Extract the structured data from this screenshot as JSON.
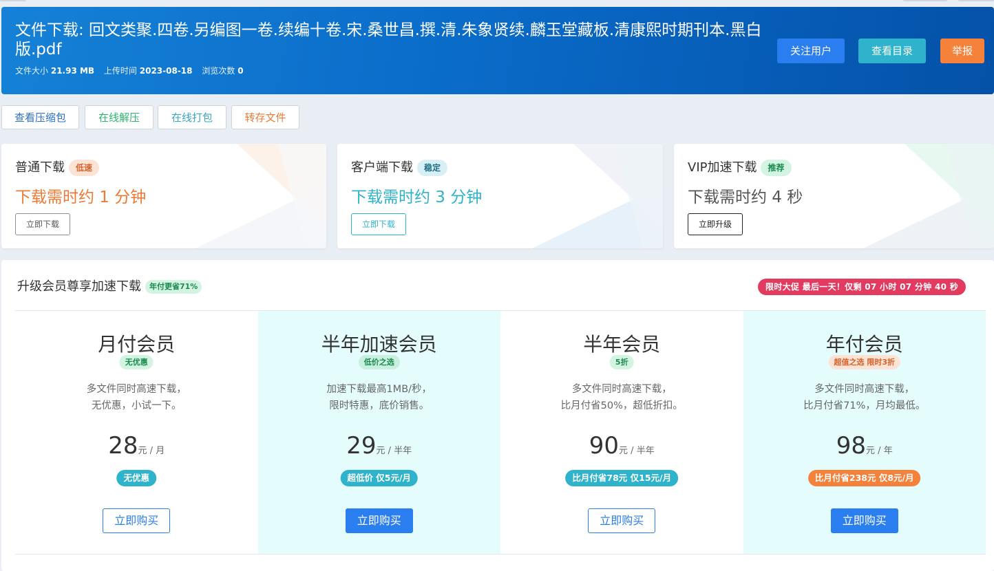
{
  "header": {
    "title": "文件下载: 回文类聚.四卷.另编图一卷.续编十卷.宋.桑世昌.撰.清.朱象贤续.麟玉堂藏板.清康熙时期刊本.黑白版.pdf",
    "size_label": "文件大小",
    "size_value": "21.93 MB",
    "upload_label": "上传时间",
    "upload_value": "2023-08-18",
    "views_label": "浏览次数",
    "views_value": "0",
    "follow_label": "关注用户",
    "catalog_label": "查看目录",
    "report_label": "举报"
  },
  "tools": {
    "view_archive": "查看压缩包",
    "extract_online": "在线解压",
    "pack_online": "在线打包",
    "save_file": "转存文件"
  },
  "download_cards": [
    {
      "title": "普通下载",
      "badge": "低速",
      "time": "下载需时约 1 分钟",
      "button": "立即下载"
    },
    {
      "title": "客户端下载",
      "badge": "稳定",
      "time": "下载需时约 3 分钟",
      "button": "立即下载"
    },
    {
      "title": "VIP加速下载",
      "badge": "推荐",
      "time": "下载需时约 4 秒",
      "button": "立即升级"
    }
  ],
  "membership": {
    "title": "升级会员尊享加速下载",
    "title_badge": "年付更省71%",
    "promo": "限时大促 最后一天！仅剩 07 小时 07 分钟 40 秒",
    "plans": [
      {
        "name": "月付会员",
        "tag": "无优惠",
        "desc1": "多文件同时高速下载，",
        "desc2": "无优惠，小试一下。",
        "price": "28",
        "unit": "元 / 月",
        "save": "无优惠",
        "buy": "立即购买"
      },
      {
        "name": "半年加速会员",
        "tag": "低价之选",
        "desc1": "加速下载最高1MB/秒，",
        "desc2": "限时特惠，底价销售。",
        "price": "29",
        "unit": "元 / 半年",
        "save": "超低价 仅5元/月",
        "buy": "立即购买"
      },
      {
        "name": "半年会员",
        "tag": "5折",
        "desc1": "多文件同时高速下载，",
        "desc2": "比月付省50%，超低折扣。",
        "price": "90",
        "unit": "元 / 半年",
        "save": "比月付省78元 仅15元/月",
        "buy": "立即购买"
      },
      {
        "name": "年付会员",
        "tag": "超值之选 限时3折",
        "desc1": "多文件同时高速下载，",
        "desc2": "比月付省71%，月均最低。",
        "price": "98",
        "unit": "元 / 年",
        "save": "比月付省238元 仅8元/月",
        "buy": "立即购买"
      }
    ]
  },
  "colors": {
    "primary_blue": "#2b7ef0",
    "cyan": "#2fb2cb",
    "orange": "#f5813b",
    "promo_red": "#e33a5f",
    "highlight_bg": "#e5fcfc"
  }
}
